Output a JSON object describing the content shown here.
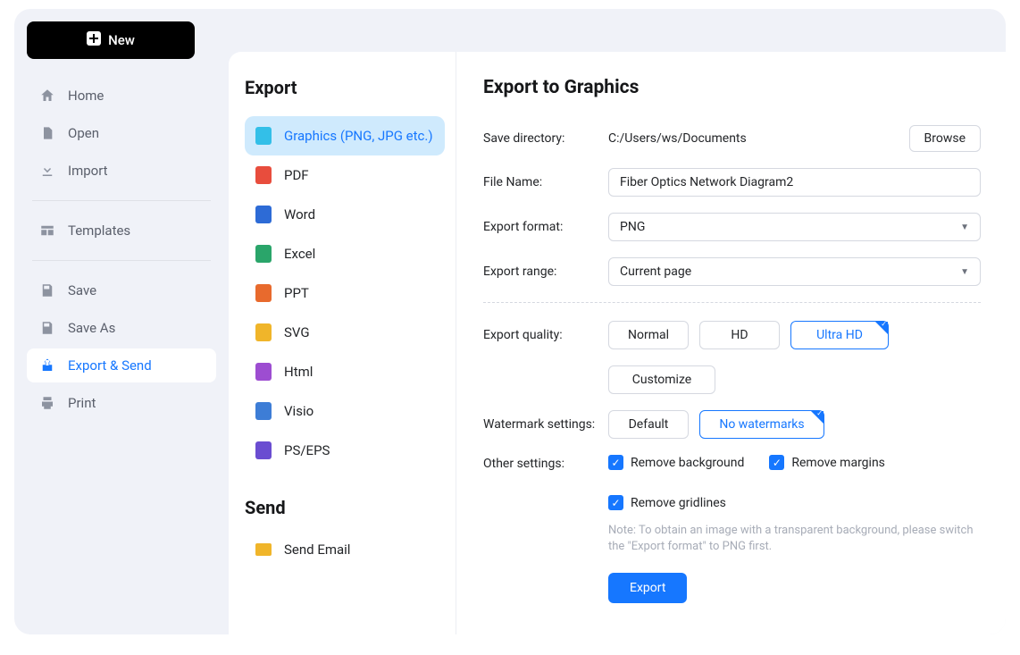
{
  "new_button": "New",
  "sidebar": {
    "group1": [
      "Home",
      "Open",
      "Import"
    ],
    "templates": "Templates",
    "group2": [
      "Save",
      "Save As",
      "Export & Send",
      "Print"
    ]
  },
  "export": {
    "title": "Export",
    "items": [
      {
        "label": "Graphics (PNG, JPG etc.)",
        "color": "#33bfe8"
      },
      {
        "label": "PDF",
        "color": "#e84d3d"
      },
      {
        "label": "Word",
        "color": "#2d6bd6"
      },
      {
        "label": "Excel",
        "color": "#2aa56a"
      },
      {
        "label": "PPT",
        "color": "#e86a2d"
      },
      {
        "label": "SVG",
        "color": "#f0b52a"
      },
      {
        "label": "Html",
        "color": "#9d4dd1"
      },
      {
        "label": "Visio",
        "color": "#3d7dd6"
      },
      {
        "label": "PS/EPS",
        "color": "#6a4dd1"
      }
    ]
  },
  "send": {
    "title": "Send",
    "email": "Send Email"
  },
  "panel": {
    "title": "Export to Graphics",
    "save_dir_label": "Save directory:",
    "save_dir_value": "C:/Users/ws/Documents",
    "browse": "Browse",
    "file_name_label": "File Name:",
    "file_name_value": "Fiber Optics Network Diagram2",
    "format_label": "Export format:",
    "format_value": "PNG",
    "range_label": "Export range:",
    "range_value": "Current page",
    "quality_label": "Export quality:",
    "quality_normal": "Normal",
    "quality_hd": "HD",
    "quality_ultra": "Ultra HD",
    "customize": "Customize",
    "watermark_label": "Watermark settings:",
    "watermark_default": "Default",
    "watermark_none": "No watermarks",
    "other_label": "Other settings:",
    "remove_bg": "Remove background",
    "remove_margins": "Remove margins",
    "remove_gridlines": "Remove gridlines",
    "note": "Note: To obtain an image with a transparent background, please switch the \"Export format\" to PNG first.",
    "export_btn": "Export"
  }
}
